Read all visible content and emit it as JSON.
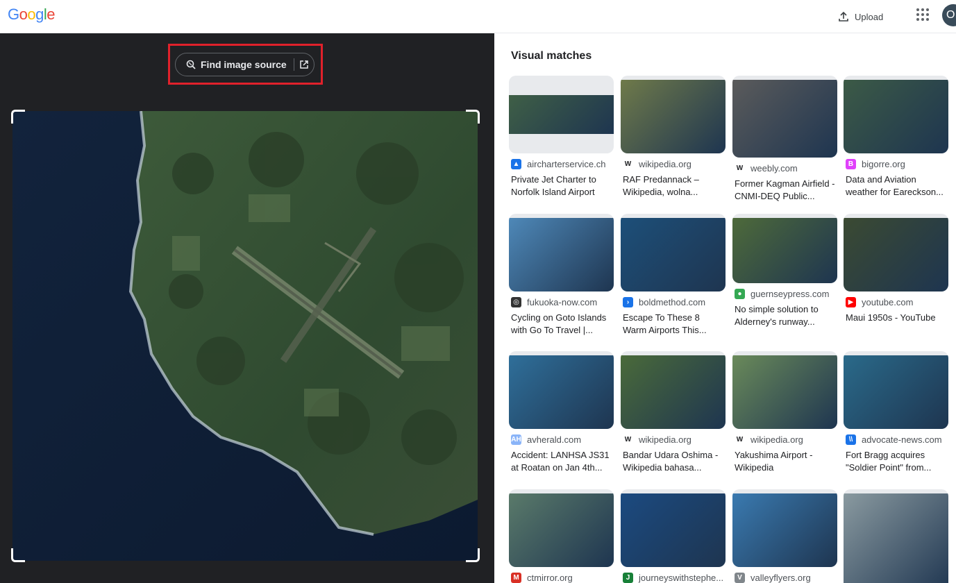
{
  "header": {
    "logo_letters": [
      {
        "ch": "G",
        "color": "#4285f4"
      },
      {
        "ch": "o",
        "color": "#ea4335"
      },
      {
        "ch": "o",
        "color": "#fbbc05"
      },
      {
        "ch": "g",
        "color": "#4285f4"
      },
      {
        "ch": "l",
        "color": "#34a853"
      },
      {
        "ch": "e",
        "color": "#ea4335"
      }
    ],
    "upload_label": "Upload",
    "apps_icon": "apps-grid-icon",
    "avatar_initial": "O"
  },
  "lens": {
    "find_source_label": "Find image source",
    "lens_icon": "lens-search-icon",
    "open_icon": "open-in-new-icon"
  },
  "results": {
    "title": "Visual matches",
    "cards": [
      {
        "site": "aircharterservice.ch",
        "title": "Private Jet Charter to Norfolk Island Airport",
        "fav_color": "#1a73e8",
        "fav_text": "▲"
      },
      {
        "site": "wikipedia.org",
        "title": "RAF Predannack – Wikipedia, wolna...",
        "fav_color": "#ffffff",
        "fav_text": "W"
      },
      {
        "site": "weebly.com",
        "title": "Former Kagman Airfield - CNMI-DEQ Public...",
        "fav_color": "#ffffff",
        "fav_text": "W"
      },
      {
        "site": "bigorre.org",
        "title": "Data and Aviation weather for Eareckson...",
        "fav_color": "#e040fb",
        "fav_text": "B"
      },
      {
        "site": "fukuoka-now.com",
        "title": "Cycling on Goto Islands with Go To Travel |...",
        "fav_color": "#333333",
        "fav_text": "◎"
      },
      {
        "site": "boldmethod.com",
        "title": "Escape To These 8 Warm Airports This...",
        "fav_color": "#1a73e8",
        "fav_text": "›"
      },
      {
        "site": "guernseypress.com",
        "title": "No simple solution to Alderney's runway...",
        "fav_color": "#34a853",
        "fav_text": "●"
      },
      {
        "site": "youtube.com",
        "title": "Maui 1950s - YouTube",
        "fav_color": "#ff0000",
        "fav_text": "▶"
      },
      {
        "site": "avherald.com",
        "title": "Accident: LANHSA JS31 at Roatan on Jan 4th...",
        "fav_color": "#8ab4f8",
        "fav_text": "AH"
      },
      {
        "site": "wikipedia.org",
        "title": "Bandar Udara Oshima - Wikipedia bahasa...",
        "fav_color": "#ffffff",
        "fav_text": "W"
      },
      {
        "site": "wikipedia.org",
        "title": "Yakushima Airport - Wikipedia",
        "fav_color": "#ffffff",
        "fav_text": "W"
      },
      {
        "site": "advocate-news.com",
        "title": "Fort Bragg acquires \"Soldier Point\" from...",
        "fav_color": "#1a73e8",
        "fav_text": "\\\\"
      },
      {
        "site": "ctmirror.org",
        "title": "",
        "fav_color": "#d93025",
        "fav_text": "M"
      },
      {
        "site": "journeyswithstephe...",
        "title": "",
        "fav_color": "#188038",
        "fav_text": "J"
      },
      {
        "site": "valleyflyers.org",
        "title": "",
        "fav_color": "#80868b",
        "fav_text": "V"
      },
      {
        "site": "",
        "title": "",
        "fav_color": "#ffffff",
        "fav_text": ""
      }
    ]
  }
}
